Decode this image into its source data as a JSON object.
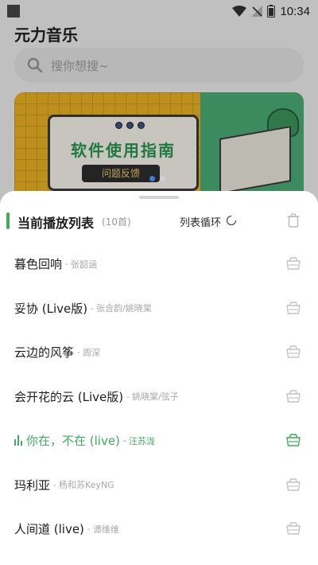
{
  "status_bar": {
    "time": "10:34"
  },
  "app": {
    "title": "元力音乐",
    "search_placeholder": "搜你想搜~"
  },
  "banner": {
    "title": "软件使用指南",
    "button": "问题反馈"
  },
  "sheet": {
    "title": "当前播放列表",
    "count": "(10首)",
    "play_mode": "列表循环",
    "songs": [
      {
        "title": "暮色回响",
        "separator": "-",
        "artist": "张韶涵",
        "active": false
      },
      {
        "title": "妥协 (Live版)",
        "separator": "-",
        "artist": "张含韵/姚晓棠",
        "active": false
      },
      {
        "title": "云边的风筝",
        "separator": "-",
        "artist": "周深",
        "active": false
      },
      {
        "title": "会开花的云 (Live版)",
        "separator": "-",
        "artist": "姚晓棠/弦子",
        "active": false
      },
      {
        "title": "你在，不在 (live)",
        "separator": "-",
        "artist": "汪苏泷",
        "active": true
      },
      {
        "title": "玛利亚",
        "separator": "-",
        "artist": "杨和苏KeyNG",
        "active": false
      },
      {
        "title": "人间道 (live)",
        "separator": "-",
        "artist": "谭维维",
        "active": false
      }
    ]
  },
  "colors": {
    "accent": "#3dae5a",
    "text": "#1d1d1d",
    "muted": "#a8a8a8"
  }
}
